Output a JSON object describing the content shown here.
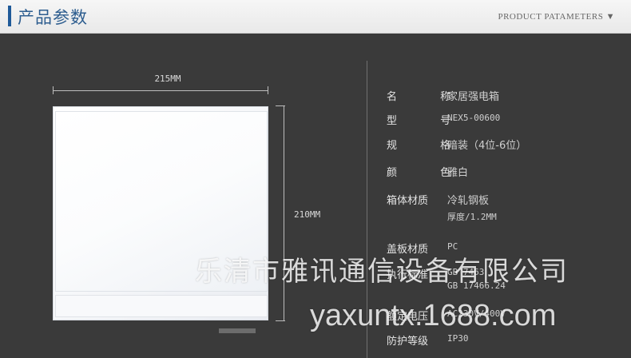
{
  "header": {
    "title": "产品参数",
    "subtitle": "PRODUCT PATAMETERS ▼"
  },
  "dimensions": {
    "width": "215MM",
    "height": "210MM"
  },
  "specs": [
    {
      "label": "名 称",
      "value": "家居强电箱"
    },
    {
      "label": "型 号",
      "value": "NEX5-00600"
    },
    {
      "label": "规 格",
      "value": "暗装（4位-6位）"
    },
    {
      "label": "颜 色",
      "value": "雅白"
    },
    {
      "label": "箱体材质",
      "value": "冷轧钢板",
      "value2": "厚度/1.2MM"
    },
    {
      "label": "盖板材质",
      "value": "PC"
    },
    {
      "label": "执行标准",
      "value": "GB 7463",
      "value2": "GB 17466.24"
    },
    {
      "label": "额定电压",
      "value": "AC230V/400V"
    },
    {
      "label": "防护等级",
      "value": "IP30"
    }
  ],
  "watermark": {
    "company": "乐清市雅讯通信设备有限公司",
    "url": "yaxuntx.1688.com"
  }
}
